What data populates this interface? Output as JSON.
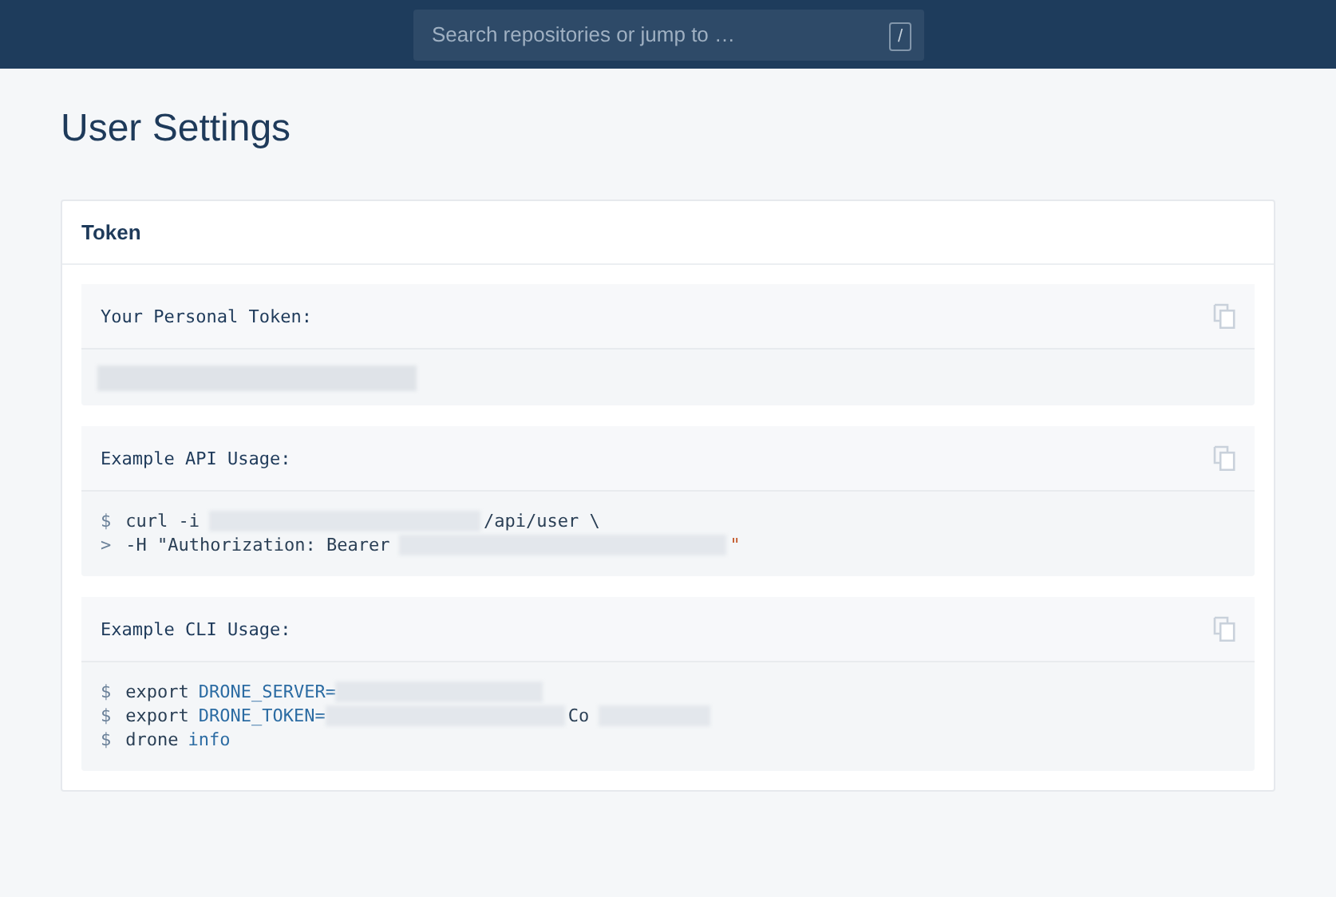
{
  "header": {
    "search": {
      "placeholder": "Search repositories or jump to …",
      "shortcut": "/"
    }
  },
  "page_title": "User Settings",
  "card": {
    "title": "Token",
    "sections": [
      {
        "label": "Your Personal Token:",
        "lines": [
          [
            {
              "kind": "redacted"
            }
          ]
        ]
      },
      {
        "label": "Example API Usage:",
        "lines": [
          [
            {
              "kind": "prompt",
              "text": "$"
            },
            {
              "kind": "text",
              "text": "curl -i"
            },
            {
              "kind": "redacted"
            },
            {
              "kind": "text",
              "text": "/api/user \\"
            }
          ],
          [
            {
              "kind": "prompt",
              "text": ">"
            },
            {
              "kind": "text",
              "text": "-H \"Authorization: Bearer"
            },
            {
              "kind": "redacted"
            },
            {
              "kind": "string",
              "text": "\""
            }
          ]
        ]
      },
      {
        "label": "Example CLI Usage:",
        "lines": [
          [
            {
              "kind": "prompt",
              "text": "$"
            },
            {
              "kind": "text",
              "text": "export"
            },
            {
              "kind": "keyword",
              "text": "DRONE_SERVER="
            },
            {
              "kind": "redacted"
            }
          ],
          [
            {
              "kind": "prompt",
              "text": "$"
            },
            {
              "kind": "text",
              "text": "export"
            },
            {
              "kind": "keyword",
              "text": "DRONE_TOKEN="
            },
            {
              "kind": "redacted"
            },
            {
              "kind": "text",
              "text": "Co"
            },
            {
              "kind": "redacted"
            }
          ],
          [
            {
              "kind": "prompt",
              "text": "$"
            },
            {
              "kind": "text",
              "text": "drone"
            },
            {
              "kind": "keyword",
              "text": "info"
            }
          ]
        ]
      }
    ]
  }
}
